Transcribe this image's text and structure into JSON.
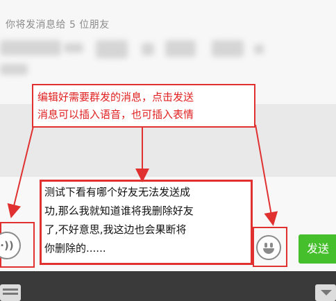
{
  "recipients": {
    "title": "你将发消息给 5 位朋友"
  },
  "annotation": {
    "text": "编辑好需要群发的消息，点击发送\n消息可以插入语音，也可插入表情"
  },
  "composer": {
    "message_text": "测试下看有哪个好友无法发送成\n功,那么我就知道谁将我删除好友\n了,不好意思,我这边也会果断将\n你删除的......",
    "send_label": "发送",
    "voice_icon": "voice-icon",
    "emoji_icon": "emoji-smile-icon"
  },
  "bottom_bar": {
    "keyboard_icon": "keyboard-icon",
    "collapse_icon": "collapse-icon"
  },
  "colors": {
    "annotation_red": "#e03030",
    "send_green": "#45bf2b"
  }
}
